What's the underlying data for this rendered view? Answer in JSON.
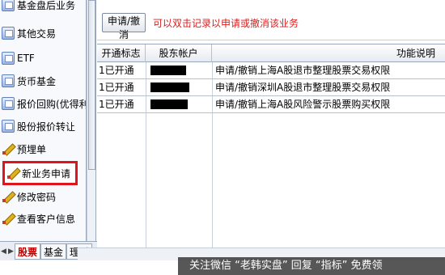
{
  "sidebar": {
    "items": [
      {
        "label": "基金盘后业务",
        "icon": "folder-icon"
      },
      {
        "label": "其他交易",
        "icon": "folder-icon"
      },
      {
        "label": "ETF",
        "icon": "folder-icon"
      },
      {
        "label": "货币基金",
        "icon": "folder-icon"
      },
      {
        "label": "报价回购(优得利1号)",
        "icon": "folder-icon"
      },
      {
        "label": "股份报价转让",
        "icon": "folder-icon"
      },
      {
        "label": "预埋单",
        "icon": "pencil-icon"
      },
      {
        "label": "新业务申请",
        "icon": "pencil-icon",
        "highlighted": true
      },
      {
        "label": "修改密码",
        "icon": "pencil-icon"
      },
      {
        "label": "查看客户信息",
        "icon": "pencil-icon"
      }
    ]
  },
  "bottom_tabs": {
    "left_arrow": "◀",
    "right_arrow": "▶",
    "tabs": [
      "股票",
      "基金",
      "理财"
    ]
  },
  "toolbar": {
    "apply_button": "申请/撤消",
    "hint": "可以双击记录以申请或撤消该业务"
  },
  "table": {
    "columns": [
      "开通标志",
      "股东帐户",
      "",
      "功能说明"
    ],
    "rows": [
      {
        "status": "1已开通",
        "account": "",
        "description": "申请/撤销上海A股退市整理股票交易权限"
      },
      {
        "status": "1已开通",
        "account": "",
        "description": "申请/撤销深圳A股退市整理股票交易权限"
      },
      {
        "status": "1已开通",
        "account": "",
        "description": "申请/撤销上海A股风险警示股票购买权限"
      }
    ]
  },
  "watermark": "关注微信 “老韩实盘” 回复 “指标” 免费领",
  "colors": {
    "highlight_border": "#e0141c",
    "hint_text": "#e01b1b",
    "redaction": "#000000"
  }
}
